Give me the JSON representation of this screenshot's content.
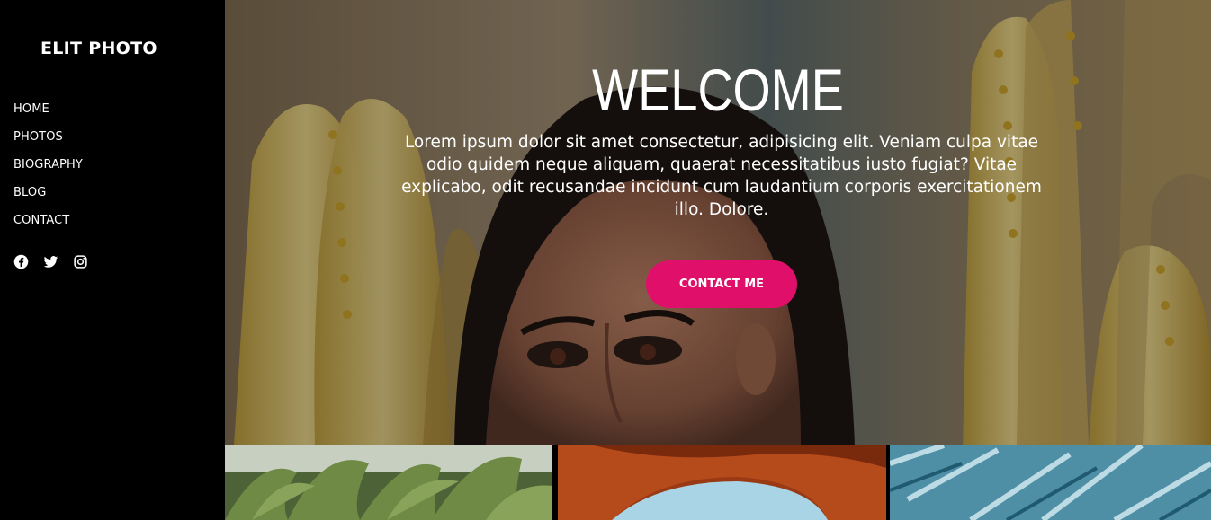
{
  "sidebar": {
    "brand": "ELIT PHOTO",
    "nav": [
      {
        "label": "HOME"
      },
      {
        "label": "PHOTOS"
      },
      {
        "label": "BIOGRAPHY"
      },
      {
        "label": "BLOG"
      },
      {
        "label": "CONTACT"
      }
    ],
    "social_icons": [
      "facebook-icon",
      "twitter-icon",
      "instagram-icon"
    ]
  },
  "hero": {
    "title": "WELCOME",
    "text": "Lorem ipsum dolor sit amet consectetur, adipisicing elit. Veniam culpa vitae odio quidem neque aliquam, quaerat necessitatibus iusto fugiat? Vitae explicabo, odit recusandae incidunt cum laudantium corporis exercitationem illo. Dolore.",
    "cta_label": "CONTACT ME"
  },
  "gallery": [
    "green-plants-photo",
    "red-rock-arch-photo",
    "blue-ice-photo"
  ],
  "colors": {
    "sidebar_bg": "#000000",
    "accent": "#e0106a",
    "text": "#ffffff"
  }
}
